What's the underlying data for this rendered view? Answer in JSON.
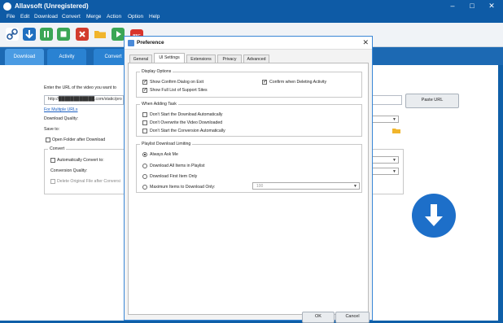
{
  "window": {
    "title": "Allavsoft (Unregistered)"
  },
  "menu": [
    "File",
    "Edit",
    "Download",
    "Convert",
    "Merge",
    "Action",
    "Option",
    "Help"
  ],
  "toolbar_icons": [
    "link-icon",
    "download-icon",
    "pause-icon",
    "stop-icon",
    "delete-icon",
    "folder-icon",
    "play-icon",
    "record-icon"
  ],
  "toolbar": {
    "rec_label": "REC"
  },
  "main_tabs": [
    "Download",
    "Activity",
    "Convert"
  ],
  "main": {
    "url_prompt": "Enter the URL of the video you want to",
    "url_value": "http://████████████.com/static/pro",
    "paste_url": "Paste URL",
    "multiple_urls": "For Multiple URLs",
    "download_quality": "Download Quality:",
    "save_to": "Save to:",
    "open_folder": "Open Folder after Download",
    "convert_group": "Convert",
    "auto_convert": "Automatically Convert to:",
    "conversion_quality": "Conversion Quality:",
    "delete_original": "Delete Original File after Conversi"
  },
  "dialog": {
    "title": "Preference",
    "tabs": [
      "General",
      "UI Settings",
      "Extensions",
      "Privacy",
      "Advanced"
    ],
    "active_tab": "UI Settings",
    "display_options": {
      "title": "Display Options",
      "show_confirm_exit": {
        "label": "Show Confirm Dialog on Exit",
        "checked": true
      },
      "confirm_delete": {
        "label": "Confirm when Deleting Activity",
        "checked": true
      },
      "show_full_list": {
        "label": "Show Full List of Support Sites",
        "checked": true
      }
    },
    "when_adding": {
      "title": "When Adding Task",
      "items": [
        {
          "label": "Don't Start the Download Automatically",
          "checked": false
        },
        {
          "label": "Don't Overwrite the Video Downloaded",
          "checked": false
        },
        {
          "label": "Don't Start the Conversion Automatically",
          "checked": false
        }
      ]
    },
    "playlist": {
      "title": "Playlist Download Limiting",
      "options": [
        {
          "label": "Always Ask Me",
          "selected": true
        },
        {
          "label": "Download All Items in Playlist",
          "selected": false
        },
        {
          "label": "Download First Item Only",
          "selected": false
        },
        {
          "label": "Maximum Items to Download Only:",
          "selected": false
        }
      ],
      "max_items_value": "100"
    },
    "ok": "OK",
    "cancel": "Cancel"
  }
}
